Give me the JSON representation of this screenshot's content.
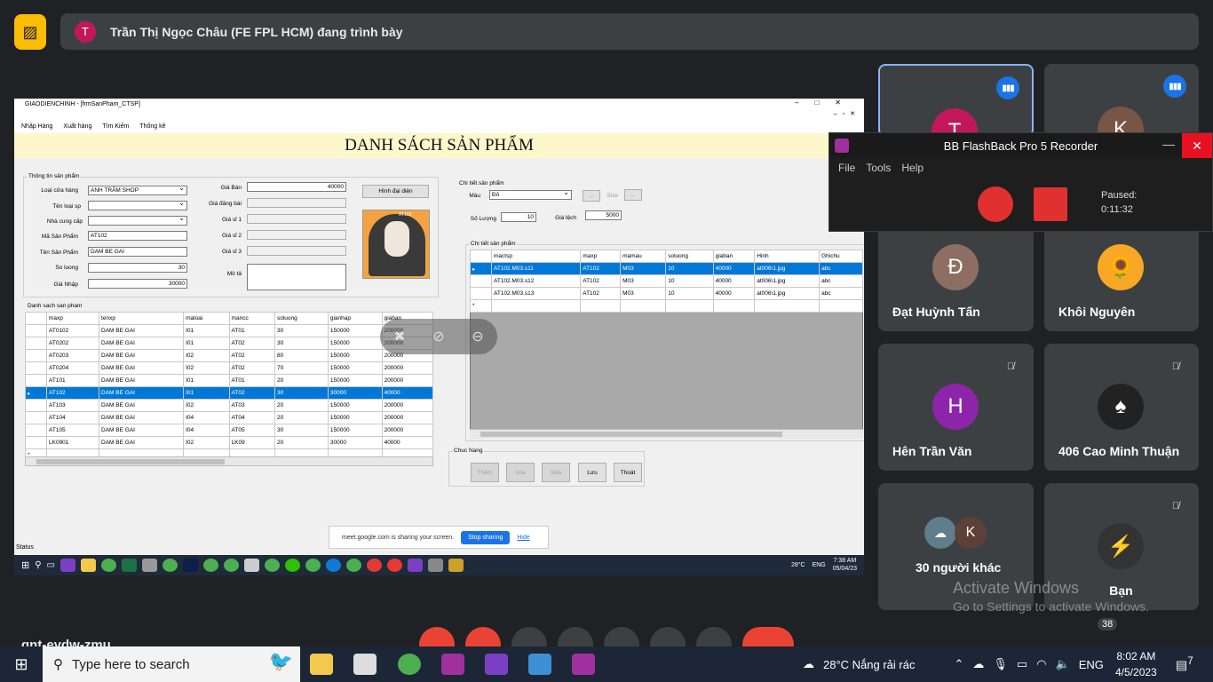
{
  "meet": {
    "presenter_initial": "T",
    "presenter_text": "Trần Thị Ngọc Châu (FE FPL HCM) đang trình bày",
    "meeting_code": "qnt-eydw-zmu",
    "participants_badge": "38",
    "activate_line1": "Activate Windows",
    "activate_line2": "Go to Settings to activate Windows."
  },
  "tiles": [
    {
      "name": "Đạt Huỳnh Tấn",
      "initial": "Đ",
      "color": "#8d6e63"
    },
    {
      "name": "Khôi Nguyên",
      "initial": "",
      "color": "#f9a825"
    },
    {
      "name": "Hên Trần Văn",
      "initial": "H",
      "color": "#8e24aa"
    },
    {
      "name": "406 Cao Minh Thuận",
      "initial": "",
      "color": "#222222"
    },
    {
      "name": "30 người khác",
      "initial": "K",
      "color": "#5d4037"
    },
    {
      "name": "Bạn",
      "initial": "",
      "color": "#333333"
    }
  ],
  "top_tiles": [
    {
      "initial": "T",
      "color": "#c2185b"
    },
    {
      "initial": "K",
      "color": "#795548"
    }
  ],
  "recorder": {
    "title": "BB FlashBack Pro 5 Recorder",
    "menu": [
      "File",
      "Tools",
      "Help"
    ],
    "status": "Paused:",
    "time": "0:11:32"
  },
  "app": {
    "window_title": "GIAODIENCHINH - [frmSanPham_CTSP]",
    "menu": [
      "Nhập Hàng",
      "Xuất hàng",
      "Tìm Kiếm",
      "Thống kê"
    ],
    "heading": "DANH SÁCH SẢN PHẨM",
    "info_group": "Thông tin sản phẩm",
    "labels": {
      "loai": "Loại cửa hàng",
      "tenloai": "Tên loại sp",
      "ncc": "Nhà cung cấp",
      "masp": "Mã Sản Phẩm",
      "tensp": "Tên Sản Phẩm",
      "soluong": "So luong",
      "gianhap": "Giá Nhập",
      "giaban": "Giá Bán",
      "giadangbai": "Giá đăng bài",
      "gias1": "Giá sỉ 1",
      "gias2": "Giá sỉ 2",
      "gias3": "Giá sỉ 3",
      "mota": "Mô tả"
    },
    "values": {
      "loai": "ANH TRÂM SHOP",
      "masp": "AT102",
      "tensp": "DAM BE GAI",
      "soluong": "30",
      "gianhap": "30000",
      "giaban": "40000"
    },
    "image_button": "Hình đại diện",
    "image_caption": "AT102",
    "detail_group": "Chi tiết sản phẩm",
    "detail_labels": {
      "mau": "Màu",
      "size": "Size",
      "soluong": "Số Lượng",
      "gialech": "Giá lệch"
    },
    "detail_values": {
      "mau": "Đỏ",
      "soluong": "10",
      "gialech": "5000",
      "dots": "..."
    },
    "list_group": "Danh sach san pham",
    "list_columns": [
      "maxp",
      "tenxp",
      "maloai",
      "mancc",
      "soluong",
      "gianhap",
      "giaban"
    ],
    "list_rows": [
      [
        "AT0102",
        "DAM BE GAI",
        "I01",
        "AT01",
        "30",
        "150000",
        "200000"
      ],
      [
        "AT0202",
        "DAM BE GAI",
        "I01",
        "AT02",
        "30",
        "150000",
        "200000"
      ],
      [
        "AT0203",
        "DAM BE GAI",
        "I02",
        "AT02",
        "80",
        "150000",
        "200000"
      ],
      [
        "AT0204",
        "DAM BE GAI",
        "I02",
        "AT02",
        "70",
        "150000",
        "200000"
      ],
      [
        "AT101",
        "DAM BE GAI",
        "I01",
        "AT01",
        "20",
        "150000",
        "200000"
      ],
      [
        "AT102",
        "DAM BE GAI",
        "I01",
        "AT02",
        "30",
        "30000",
        "40000"
      ],
      [
        "AT103",
        "DAM BE GAI",
        "I02",
        "AT03",
        "20",
        "150000",
        "200000"
      ],
      [
        "AT104",
        "DAM BE GAI",
        "I04",
        "AT04",
        "20",
        "150000",
        "200000"
      ],
      [
        "AT105",
        "DAM BE GAI",
        "I04",
        "AT05",
        "30",
        "150000",
        "200000"
      ],
      [
        "LK0901",
        "DAM BE GAI",
        "I02",
        "LK09",
        "20",
        "30000",
        "40000"
      ]
    ],
    "list_selected": 5,
    "ctsp_group": "Chi tiết sản phẩm",
    "ctsp_columns": [
      "mactsp",
      "maxp",
      "mamau",
      "soluong",
      "giaban",
      "Hinh",
      "Ghichu"
    ],
    "ctsp_rows": [
      [
        "AT102.M03.s11",
        "AT102",
        "M03",
        "10",
        "40000",
        "at006\\1.jpg",
        "abc"
      ],
      [
        "AT102.M03.s12",
        "AT102",
        "M03",
        "10",
        "40000",
        "at006\\1.jpg",
        "abc"
      ],
      [
        "AT102.M03.s13",
        "AT102",
        "M03",
        "10",
        "40000",
        "at006\\1.jpg",
        "abc"
      ]
    ],
    "func_group": "Chuc Nang",
    "buttons": [
      "Thêm",
      "Xóa",
      "Sửa",
      "Lưu",
      "Thoát"
    ],
    "status": "Status",
    "share_text": "meet.google.com is sharing your screen.",
    "stop_sharing": "Stop sharing",
    "hide": "Hide",
    "inner_weather": "28°C",
    "inner_lang": "ENG",
    "inner_time": "7:38 AM",
    "inner_date": "05/04/23"
  },
  "taskbar": {
    "search_placeholder": "Type here to search",
    "weather": "28°C  Nắng rải rác",
    "lang": "ENG",
    "time": "8:02 AM",
    "date": "4/5/2023",
    "notif": "7"
  }
}
